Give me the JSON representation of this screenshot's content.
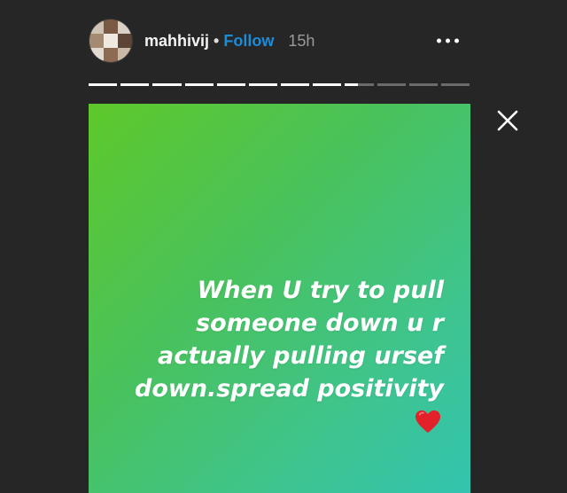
{
  "header": {
    "username": "mahhivij",
    "separator": "•",
    "follow_label": "Follow",
    "time_ago": "15h"
  },
  "story": {
    "progress": {
      "total_segments": 12,
      "completed_segments": 8,
      "current_segment_fraction": 0.45
    },
    "caption": "When U try to pull someone down u r actually pulling ursef down.spread positivity",
    "emoji": "heart-emoji",
    "gradient": [
      "#5ec82a",
      "#33c4b0"
    ]
  },
  "icons": {
    "more": "more-horizontal-icon",
    "close": "close-icon"
  }
}
